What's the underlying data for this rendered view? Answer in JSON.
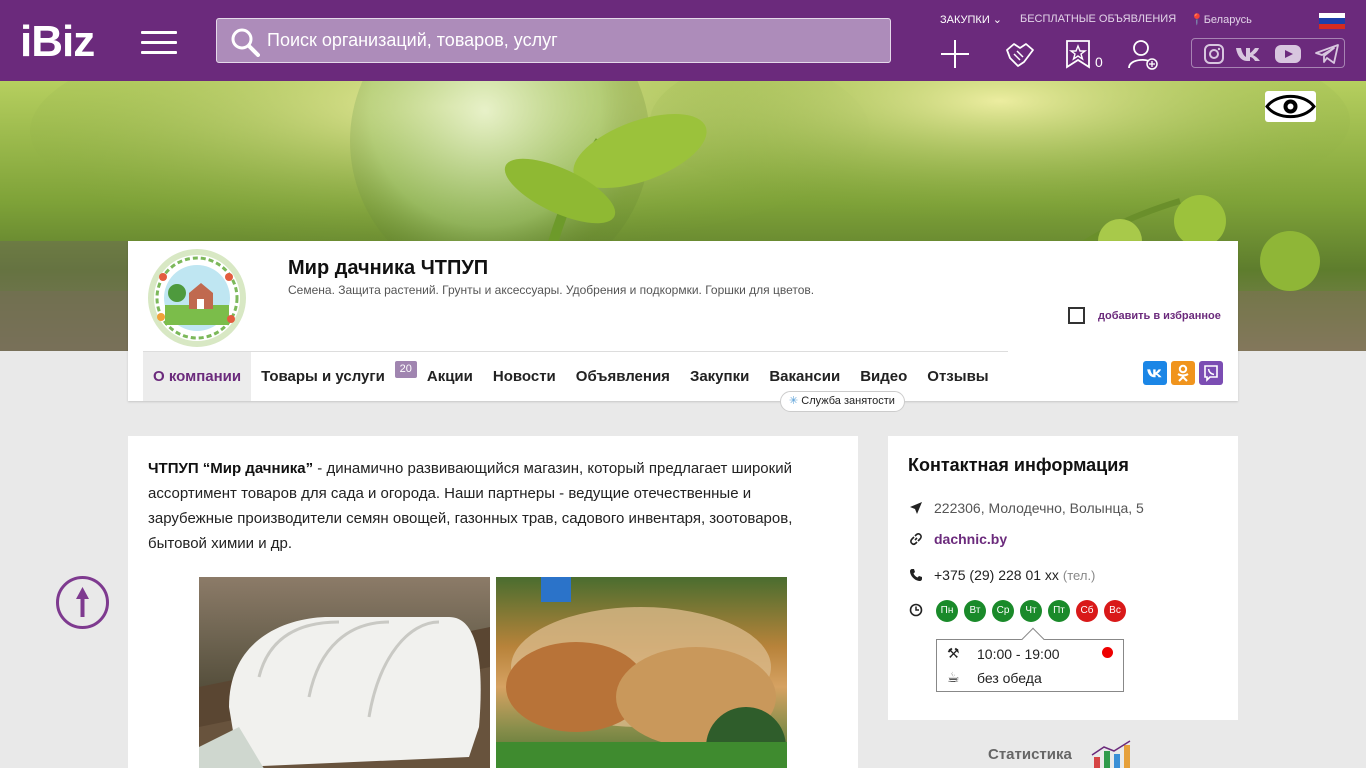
{
  "header": {
    "logo": "iBiz",
    "search_placeholder": "Поиск организаций, товаров, услуг",
    "links": {
      "purchases": "ЗАКУПКИ",
      "free_ads": "БЕСПЛАТНЫЕ ОБЪЯВЛЕНИЯ",
      "region": "Беларусь"
    },
    "favorites_count": "0",
    "colors": {
      "brand": "#6b2a7c",
      "search_bg": "#ad8cba"
    }
  },
  "company": {
    "name": "Мир дачника ЧТПУП",
    "description": "Семена. Защита растений. Грунты и аксессуары. Удобрения и подкормки. Горшки для цветов.",
    "favorite_label": "добавить в избранное"
  },
  "tabs": [
    {
      "label": "О компании",
      "active": true
    },
    {
      "label": "Товары и услуги",
      "badge": "20"
    },
    {
      "label": "Акции"
    },
    {
      "label": "Новости"
    },
    {
      "label": "Объявления"
    },
    {
      "label": "Закупки"
    },
    {
      "label": "Вакансии"
    },
    {
      "label": "Видео"
    },
    {
      "label": "Отзывы"
    }
  ],
  "employment_tag": "Служба занятости",
  "about": {
    "lead_bold": "ЧТПУП “Мир дачника”",
    "text": " - динамично развивающийся магазин, который предлагает широкий ассортимент товаров для сада и огорода. Наши партнеры - ведущие отечественные и зарубежные производители семян овощей, газонных трав,  садового инвентаря, зоотоваров, бытовой химии и др."
  },
  "contacts": {
    "title": "Контактная информация",
    "address": "222306, Молодечно, Волынца, 5",
    "website": "dachnic.by",
    "phone": "+375 (29) 228 01 xx",
    "phone_note": "(тел.)",
    "days": [
      {
        "label": "Пн",
        "open": true
      },
      {
        "label": "Вт",
        "open": true
      },
      {
        "label": "Ср",
        "open": true
      },
      {
        "label": "Чт",
        "open": true
      },
      {
        "label": "Пт",
        "open": true
      },
      {
        "label": "Сб",
        "open": false
      },
      {
        "label": "Вс",
        "open": false
      }
    ],
    "hours": "10:00 - 19:00",
    "lunch": "без обеда"
  },
  "statistics_label": "Статистика"
}
